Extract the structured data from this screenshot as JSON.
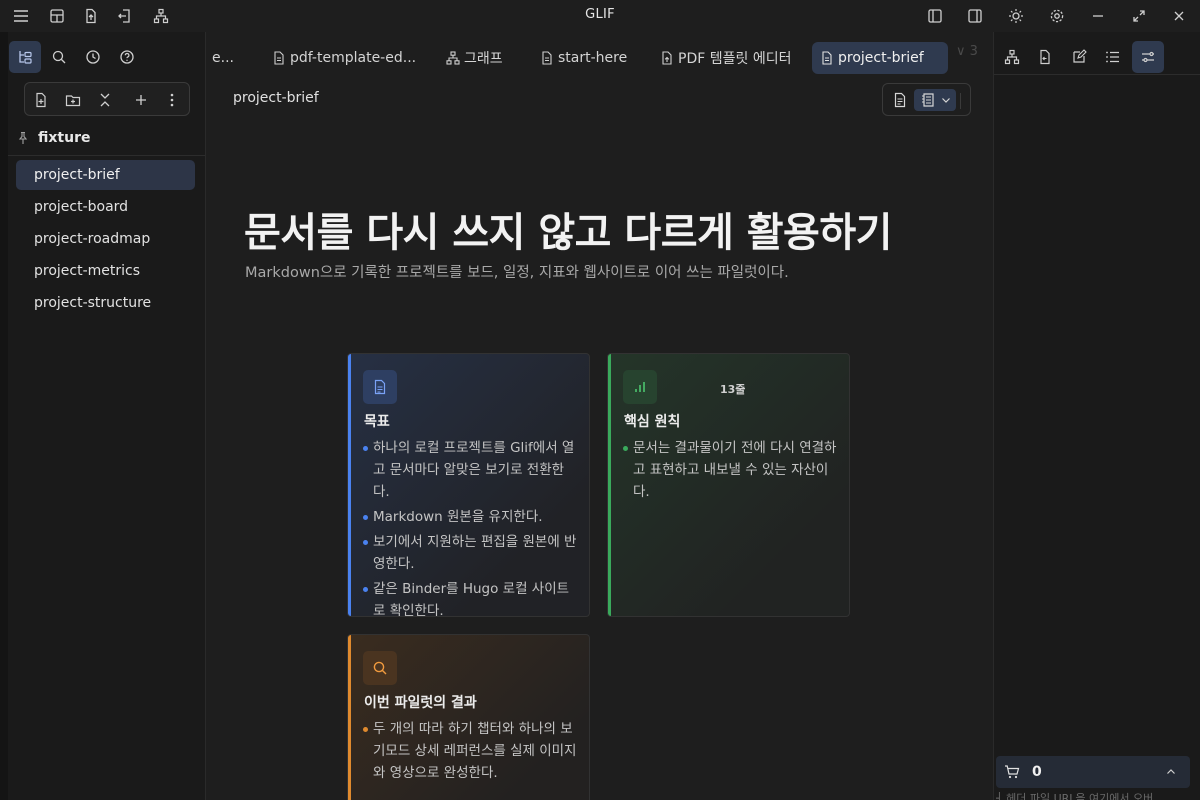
{
  "app": {
    "title": "GLIF"
  },
  "left_sidebar": {
    "vault_name": "fixture",
    "files": [
      {
        "label": "project-brief",
        "active": true
      },
      {
        "label": "project-board"
      },
      {
        "label": "project-roadmap"
      },
      {
        "label": "project-metrics"
      },
      {
        "label": "project-structure"
      }
    ]
  },
  "tabs": [
    {
      "label": "e...",
      "icon": "truncated"
    },
    {
      "label": "pdf-template-ed...",
      "icon": "file-icon"
    },
    {
      "label": "그래프",
      "icon": "graph-icon"
    },
    {
      "label": "start-here",
      "icon": "file-icon"
    },
    {
      "label": "PDF 템플릿 에디터",
      "icon": "file-upload-icon"
    },
    {
      "label": "project-brief",
      "icon": "file-icon",
      "active": true
    }
  ],
  "tab_overflow_label": "∨ 3",
  "main": {
    "breadcrumb": "project-brief",
    "title": "문서를 다시 쓰지 않고 다르게 활용하기",
    "subtitle": "Markdown으로 기록한 프로젝트를 보드, 일정, 지표와 웹사이트로 이어 쓰는 파일럿이다.",
    "cards": [
      {
        "title": "목표",
        "accent": "#4a82f0",
        "items": [
          "하나의 로컬 프로젝트를 Glif에서 열고 문서마다 알맞은 보기로 전환한다.",
          "Markdown 원본을 유지한다.",
          "보기에서 지원하는 편집을 원본에 반영한다.",
          "같은 Binder를 Hugo 로컬 사이트로 확인한다."
        ]
      },
      {
        "title": "핵심 원칙",
        "accent": "#3aaa5c",
        "badge": "13줄",
        "items": [
          "문서는 결과물이기 전에 다시 연결하고 표현하고 내보낼 수 있는 자산이다."
        ]
      },
      {
        "title": "이번 파일럿의 결과",
        "accent": "#e08a2e",
        "items": [
          "두 개의 따라 하기 챕터와 하나의 보기모드 상세 레퍼런스를 실제 이미지와 영상으로 완성한다."
        ]
      }
    ]
  },
  "right_panel": {
    "cart_count": "0",
    "peek_text": "┤ 헤더 파일 URL을 여기에서 오버..."
  },
  "colors": {
    "accent_blue": "#4a82f0",
    "accent_green": "#3aaa5c",
    "accent_orange": "#e08a2e",
    "active_tab_bg": "#2f3a4f"
  }
}
